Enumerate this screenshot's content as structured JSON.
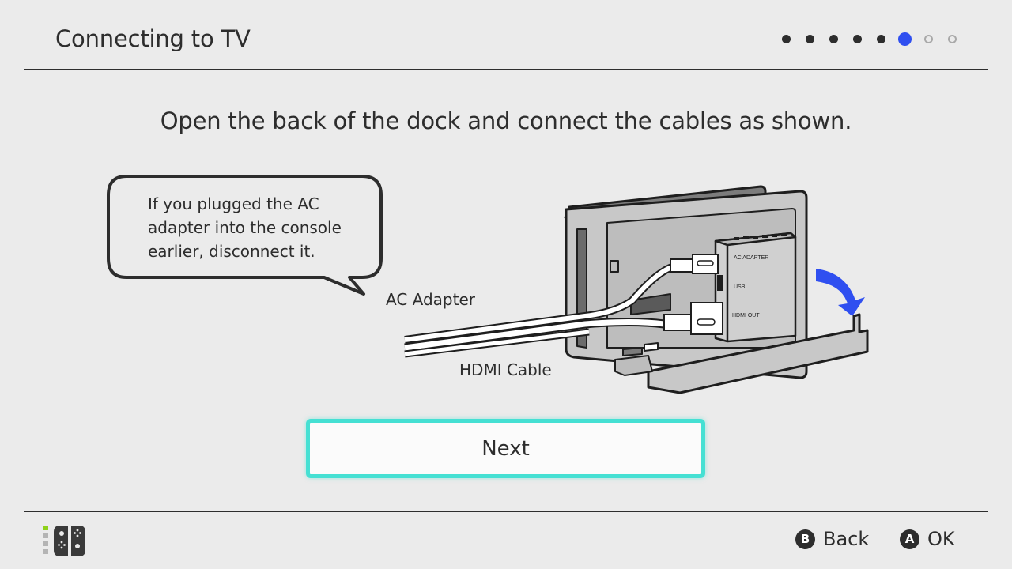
{
  "header": {
    "title": "Connecting to TV",
    "progress": {
      "total_steps": 8,
      "current_step": 6,
      "accent_color": "#2f4ff0"
    }
  },
  "main": {
    "instruction": "Open the back of the dock and connect the cables as shown.",
    "callout": "If you plugged the AC\nadapter into the console\nearlier, disconnect it.",
    "illustration": {
      "cable_labels": {
        "ac": "AC Adapter",
        "hdmi": "HDMI Cable"
      },
      "port_labels": {
        "ac": "AC ADAPTER",
        "usb": "USB",
        "hdmi": "HDMI OUT"
      },
      "arrow_color": "#2f4ff0"
    },
    "next_button": {
      "label": "Next",
      "border_color": "#45e0d3"
    }
  },
  "footer": {
    "controller_icon": "joy-con-pair-icon",
    "actions": [
      {
        "glyph": "B",
        "label": "Back"
      },
      {
        "glyph": "A",
        "label": "OK"
      }
    ]
  }
}
